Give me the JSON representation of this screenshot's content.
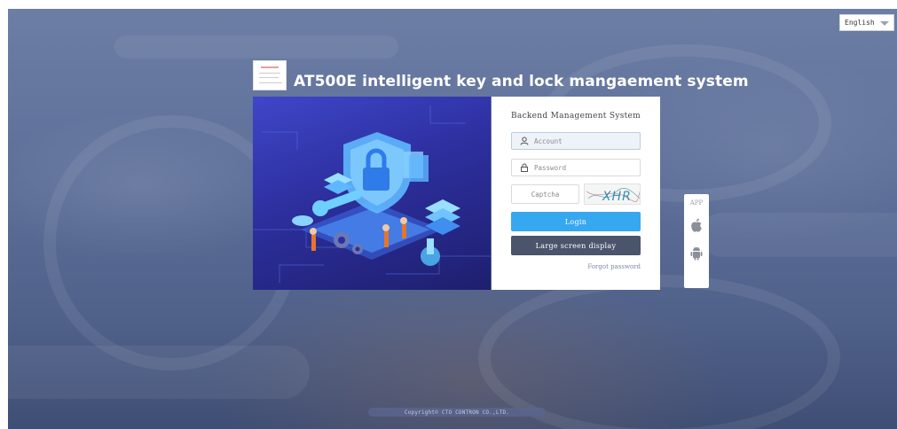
{
  "language_selector": {
    "value": "English"
  },
  "header": {
    "title": "AT500E intelligent key and lock mangaement system"
  },
  "login_panel": {
    "title": "Backend Management System",
    "account_placeholder": "Account",
    "password_placeholder": "Password",
    "captcha_placeholder": "Captcha",
    "captcha_text": "XHR",
    "login_label": "Login",
    "large_screen_label": "Large screen display",
    "forgot_label": "Forgot password"
  },
  "app_download": {
    "label": "APP",
    "icons": [
      "apple-icon",
      "android-icon"
    ]
  },
  "footer": {
    "copyright": "Copyright© CTO CONTRON CO.,LTD."
  },
  "colors": {
    "login_button": "#36a8f0",
    "large_screen_button": "#4a546a",
    "hero_background": "#2d2f9e"
  }
}
